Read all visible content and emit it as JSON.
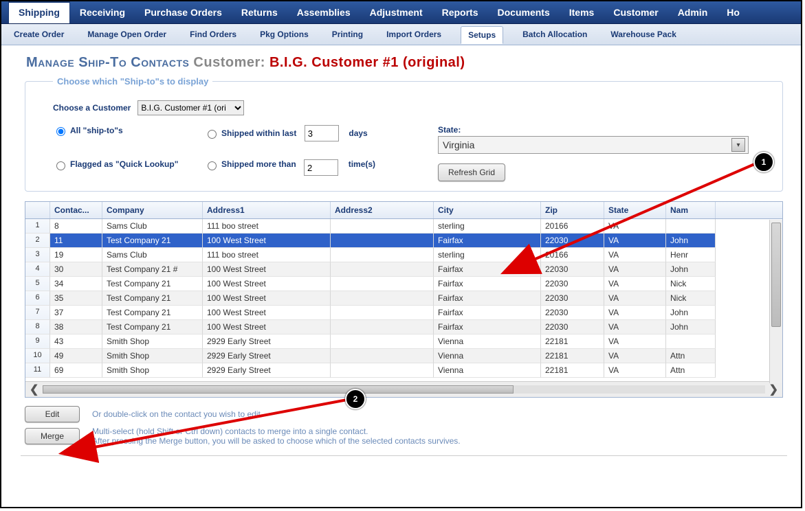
{
  "nav_main": {
    "items": [
      "Shipping",
      "Receiving",
      "Purchase Orders",
      "Returns",
      "Assemblies",
      "Adjustment",
      "Reports",
      "Documents",
      "Items",
      "Customer",
      "Admin",
      "Ho"
    ],
    "active_index": 0
  },
  "nav_sub": {
    "items": [
      "Create Order",
      "Manage Open Order",
      "Find Orders",
      "Pkg Options",
      "Printing",
      "Import Orders",
      "Setups",
      "Batch Allocation",
      "Warehouse Pack"
    ],
    "active_index": 6
  },
  "page": {
    "title": "Manage Ship-To Contacts",
    "customer_label": "Customer:",
    "customer_name": "B.I.G. Customer #1 (original)"
  },
  "filter": {
    "legend": "Choose which \"Ship-to\"s to display",
    "choose_customer_label": "Choose a Customer",
    "customer_select_value": "B.I.G. Customer #1 (ori",
    "radio_all": "All \"ship-to\"s",
    "radio_flagged": "Flagged as \"Quick Lookup\"",
    "radio_shipped_within": "Shipped within last",
    "radio_shipped_more": "Shipped more than",
    "days_value": "3",
    "days_unit": "days",
    "times_value": "2",
    "times_unit": "time(s)",
    "state_label": "State:",
    "state_value": "Virginia",
    "refresh_label": "Refresh Grid"
  },
  "grid": {
    "columns": [
      "Contac...",
      "Company",
      "Address1",
      "Address2",
      "City",
      "Zip",
      "State",
      "Nam"
    ],
    "selected_row_index": 1,
    "rows": [
      {
        "n": "1",
        "contact": "8",
        "company": "Sams Club",
        "addr1": "111 boo street",
        "addr2": "",
        "city": "sterling",
        "zip": "20166",
        "state": "VA",
        "name": ""
      },
      {
        "n": "2",
        "contact": "11",
        "company": "Test Company 21",
        "addr1": "100 West Street",
        "addr2": "",
        "city": "Fairfax",
        "zip": "22030",
        "state": "VA",
        "name": "John"
      },
      {
        "n": "3",
        "contact": "19",
        "company": "Sams Club",
        "addr1": "111 boo street",
        "addr2": "",
        "city": "sterling",
        "zip": "20166",
        "state": "VA",
        "name": "Henr"
      },
      {
        "n": "4",
        "contact": "30",
        "company": "Test Company 21 #",
        "addr1": "100 West Street",
        "addr2": "",
        "city": "Fairfax",
        "zip": "22030",
        "state": "VA",
        "name": "John"
      },
      {
        "n": "5",
        "contact": "34",
        "company": "Test Company 21",
        "addr1": "100 West Street",
        "addr2": "",
        "city": "Fairfax",
        "zip": "22030",
        "state": "VA",
        "name": "Nick"
      },
      {
        "n": "6",
        "contact": "35",
        "company": "Test Company 21",
        "addr1": "100 West Street",
        "addr2": "",
        "city": "Fairfax",
        "zip": "22030",
        "state": "VA",
        "name": "Nick"
      },
      {
        "n": "7",
        "contact": "37",
        "company": "Test Company 21",
        "addr1": "100 West Street",
        "addr2": "",
        "city": "Fairfax",
        "zip": "22030",
        "state": "VA",
        "name": "John"
      },
      {
        "n": "8",
        "contact": "38",
        "company": "Test Company 21",
        "addr1": "100 West Street",
        "addr2": "",
        "city": "Fairfax",
        "zip": "22030",
        "state": "VA",
        "name": "John"
      },
      {
        "n": "9",
        "contact": "43",
        "company": "Smith Shop",
        "addr1": "2929 Early Street",
        "addr2": "",
        "city": "Vienna",
        "zip": "22181",
        "state": "VA",
        "name": ""
      },
      {
        "n": "10",
        "contact": "49",
        "company": "Smith Shop",
        "addr1": "2929 Early Street",
        "addr2": "",
        "city": "Vienna",
        "zip": "22181",
        "state": "VA",
        "name": "Attn"
      },
      {
        "n": "11",
        "contact": "69",
        "company": "Smith Shop",
        "addr1": "2929 Early Street",
        "addr2": "",
        "city": "Vienna",
        "zip": "22181",
        "state": "VA",
        "name": "Attn"
      }
    ]
  },
  "actions": {
    "edit_label": "Edit",
    "edit_help": "Or double-click on the contact you wish to edit.",
    "merge_label": "Merge",
    "merge_help_1": "Multi-select (hold Shift or Ctrl down) contacts to merge into a single contact.",
    "merge_help_2": "After pressing the Merge button, you will be asked to choose which of the selected contacts survives."
  },
  "annotations": {
    "badge1": "1",
    "badge2": "2"
  }
}
